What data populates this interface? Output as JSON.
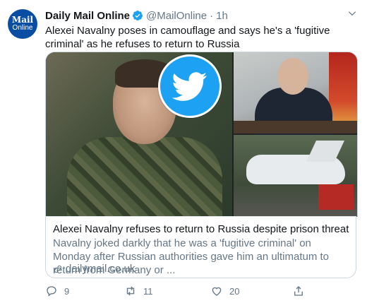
{
  "tweet": {
    "avatar_line1": "Mail",
    "avatar_line2": "Online",
    "name": "Daily Mail Online",
    "handle": "@MailOnline",
    "separator": "·",
    "time": "1h",
    "text": "Alexei Navalny poses in camouflage and says he's a 'fugitive criminal' as he refuses to return to Russia"
  },
  "card": {
    "title": "Alexei Navalny refuses to return to Russia despite prison threat",
    "description": "Navalny joked darkly that he was a 'fugitive criminal' on Monday after Russian authorities gave him an ultimatum to return from Germany or ...",
    "domain": "dailymail.co.uk"
  },
  "actions": {
    "replies": "9",
    "retweets": "11",
    "likes": "20"
  },
  "colors": {
    "accent": "#1da1f2",
    "text_secondary": "#657786",
    "brand_avatar": "#0a4ea3"
  },
  "icons": [
    "verified-icon",
    "chevron-down-icon",
    "link-icon",
    "reply-icon",
    "retweet-icon",
    "like-icon",
    "share-icon"
  ]
}
